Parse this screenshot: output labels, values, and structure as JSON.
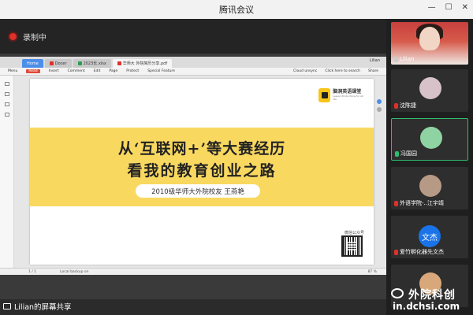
{
  "window": {
    "title": "腾讯会议"
  },
  "recording": {
    "label": "录制中"
  },
  "wps": {
    "tabs": [
      {
        "label": "Home",
        "color": "#4c8ee8"
      },
      {
        "label": "Docer",
        "color": "#e0302a"
      },
      {
        "label": "2023长.xlsx",
        "color": "#2a9d4e"
      },
      {
        "label": "华师大 外院简历分享.pdf",
        "color": "#e0302a"
      }
    ],
    "user": "Lilian",
    "menu": [
      "Menu",
      "Read",
      "Insert",
      "Comment",
      "Edit",
      "Page",
      "Protect",
      "Special Feature"
    ],
    "menu_right": [
      "Cloud unsync",
      "Click here to search",
      "Share"
    ],
    "status": {
      "page": "1 / 1",
      "sync": "Local backup on",
      "zoom": "87 %"
    }
  },
  "slide": {
    "logo_name": "脑洞英语课堂",
    "logo_sub": "Lesson Productions for all life",
    "title_line1": "从‘互联网+’等大赛经历",
    "title_line2": "看我的教育创业之路",
    "subtitle": "2010级华师大外院校友 王燕艳",
    "qr_label": "微信公众号"
  },
  "share_label": "Lilian的屏幕共享",
  "participants": [
    {
      "name": "Lilian",
      "type": "video",
      "mic": "on"
    },
    {
      "name": "沈陈捷",
      "type": "avatar",
      "mic": "muted",
      "color": "#d7c2c9"
    },
    {
      "name": "冯国园",
      "type": "avatar",
      "mic": "on",
      "color": "#8fd3a2",
      "active": true
    },
    {
      "name": "外语学院-..江宇靖",
      "type": "avatar",
      "mic": "muted",
      "color": "#b79a85"
    },
    {
      "name": "爱竹孵化器先文杰",
      "type": "text",
      "avatar_text": "文杰",
      "mic": "muted"
    },
    {
      "name": "",
      "type": "avatar",
      "mic": "muted",
      "color": "#d9a87a"
    }
  ],
  "watermark": {
    "line1": "外院科创",
    "line2": "in.dchsi.com"
  },
  "colors": {
    "accent": "#2dbd6e",
    "banner": "#f9d860",
    "record": "#e0302a"
  }
}
